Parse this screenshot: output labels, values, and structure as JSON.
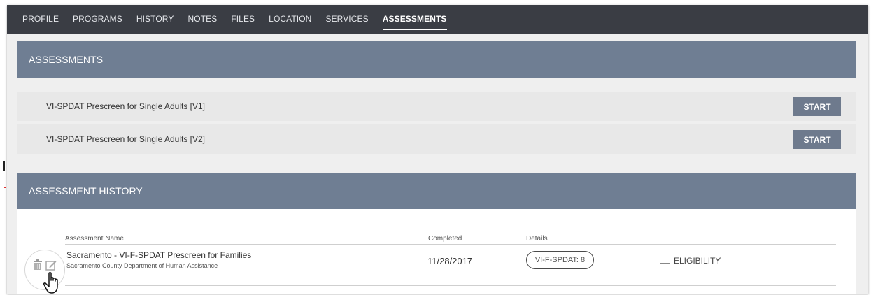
{
  "nav": {
    "tabs": [
      {
        "label": "PROFILE"
      },
      {
        "label": "PROGRAMS"
      },
      {
        "label": "HISTORY"
      },
      {
        "label": "NOTES"
      },
      {
        "label": "FILES"
      },
      {
        "label": "LOCATION"
      },
      {
        "label": "SERVICES"
      },
      {
        "label": "ASSESSMENTS",
        "active": true
      }
    ]
  },
  "assessments": {
    "title": "ASSESSMENTS",
    "items": [
      {
        "name": "VI-SPDAT Prescreen for Single Adults [V1]",
        "button": "START"
      },
      {
        "name": "VI-SPDAT Prescreen for Single Adults [V2]",
        "button": "START"
      }
    ]
  },
  "history": {
    "title": "ASSESSMENT HISTORY",
    "columns": {
      "name": "Assessment Name",
      "completed": "Completed",
      "details": "Details"
    },
    "rows": [
      {
        "name": "Sacramento - VI-F-SPDAT Prescreen for Families",
        "agency": "Sacramento County Department of Human Assistance",
        "completed": "11/28/2017",
        "score": "VI-F-SPDAT: 8",
        "eligibility": "ELIGIBILITY"
      }
    ]
  },
  "icons": [
    "trash-icon",
    "edit-icon",
    "hand-pointer-icon",
    "list-icon"
  ],
  "colors": {
    "nav_bg": "#3a3d44",
    "header_bg": "#6f7e93",
    "button_bg": "#6e7a8d",
    "panel_bg": "#efefef"
  }
}
